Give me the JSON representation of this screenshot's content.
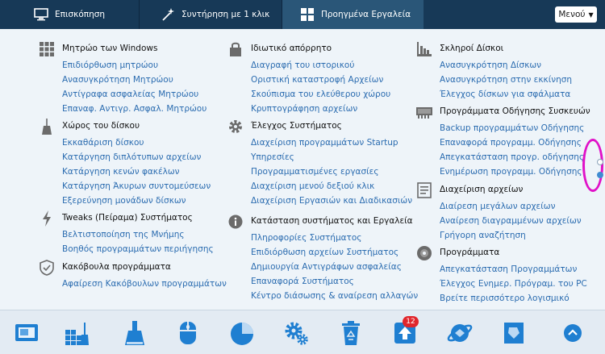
{
  "topbar": {
    "tabs": [
      {
        "label": "Επισκόπηση",
        "icon": "monitor-icon"
      },
      {
        "label": "Συντήρηση με 1 κλικ",
        "icon": "magic-wand-icon"
      },
      {
        "label": "Προηγμένα Εργαλεία",
        "icon": "grid-icon"
      }
    ],
    "menu_label": "Μενού",
    "menu_arrow": "▼"
  },
  "groups": [
    {
      "title": "Μητρώο των Windows",
      "icon": "registry-grid-icon",
      "links": [
        "Επιδιόρθωση μητρώου",
        "Ανασυγκρότηση Μητρώου",
        "Αντίγραφα ασφαλείας Μητρώου",
        "Επαναφ. Αντιγρ. Ασφαλ. Μητρώου"
      ]
    },
    {
      "title": "Χώρος του δίσκου",
      "icon": "broom-icon",
      "links": [
        "Εκκαθάριση δίσκου",
        "Κατάργηση διπλότυπων αρχείων",
        "Κατάργηση κενών φακέλων",
        "Κατάργηση Άκυρων συντομεύσεων",
        "Εξερεύνηση μονάδων δίσκων"
      ]
    },
    {
      "title": "Tweaks (Πείραμα) Συστήματος",
      "icon": "lightning-icon",
      "links": [
        "Βελτιστοποίηση της Μνήμης",
        "Βοηθός προγραμμάτων περιήγησης"
      ]
    },
    {
      "title": "Κακόβουλα προγράμματα",
      "icon": "shield-icon",
      "links": [
        "Αφαίρεση Κακόβουλων προγραμμάτων"
      ]
    },
    {
      "title": "Ιδιωτικό απόρρητο",
      "icon": "lock-icon",
      "links": [
        "Διαγραφή του ιστορικού",
        "Οριστική καταστροφή Αρχείων",
        "Σκούπισμα του ελεύθερου χώρου",
        "Κρυπτογράφηση αρχείων"
      ]
    },
    {
      "title": "Έλεγχος Συστήματος",
      "icon": "gear-icon",
      "links": [
        "Διαχείριση προγραμμάτων Startup",
        "Υπηρεσίες",
        "Προγραμματισμένες εργασίες",
        "Διαχείριση μενού δεξιού κλικ",
        "Διαχείριση Εργασιών και Διαδικασιών"
      ]
    },
    {
      "title": "Κατάσταση συστήματος και Εργαλεία",
      "icon": "info-icon",
      "links": [
        "Πληροφορίες Συστήματος",
        "Επιδιόρθωση αρχείων Συστήματος",
        "Δημιουργία Αντιγράφων ασφαλείας",
        "Επαναφορά Συστήματος",
        "Κέντρο διάσωσης & αναίρεση αλλαγών"
      ]
    },
    {
      "title": "Σκληροί Δίσκοι",
      "icon": "hard-disk-icon",
      "links": [
        "Ανασυγκρότηση Δίσκων",
        "Ανασυγκρότηση στην εκκίνηση",
        "Έλεγχος δίσκων για σφάλματα"
      ]
    },
    {
      "title": "Προγράμματα Οδήγησης Συσκευών",
      "icon": "driver-chip-icon",
      "links": [
        "Backup προγραμμάτων Οδήγησης",
        "Επαναφορά προγραμμ. Οδήγησης",
        "Απεγκατάσταση προγρ. οδήγησης",
        "Ενημέρωση προγραμμ. Οδήγησης"
      ]
    },
    {
      "title": "Διαχείριση αρχείων",
      "icon": "file-manager-icon",
      "links": [
        "Διαίρεση μεγάλων αρχείων",
        "Αναίρεση διαγραμμένων αρχείων",
        "Γρήγορη αναζήτηση"
      ]
    },
    {
      "title": "Προγράμματα",
      "icon": "disc-icon",
      "links": [
        "Απεγκατάσταση Προγραμμάτων",
        "Έλεγχος Ενημερ. Πρόγραμ. του PC",
        "Βρείτε περισσότερο λογισμικό"
      ]
    }
  ],
  "bottom_icons": [
    "screen-icon",
    "registry-clean-icon",
    "disk-cleaner-icon",
    "mouse-icon",
    "pie-chart-icon",
    "gears-icon",
    "recycle-bin-icon",
    "update-icon",
    "browser-icon",
    "file-shredder-icon",
    "scroll-up-icon"
  ],
  "update_badge": "12"
}
